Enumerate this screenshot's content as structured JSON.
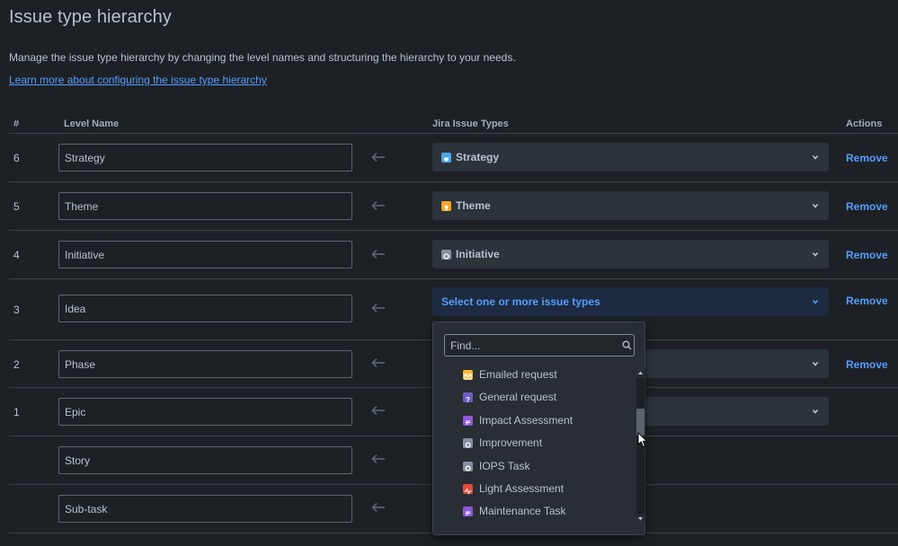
{
  "page": {
    "title": "Issue type hierarchy",
    "description": "Manage the issue type hierarchy by changing the level names and structuring the hierarchy to your needs.",
    "learn_link": "Learn more about configuring the issue type hierarchy"
  },
  "table": {
    "headers": {
      "number": "#",
      "level_name": "Level Name",
      "issue_types": "Jira Issue Types",
      "actions": "Actions"
    },
    "rows": [
      {
        "number": "6",
        "level_name": "Strategy",
        "issue_type": "Strategy",
        "icon": "strategy-icon",
        "icon_color": "#4aa7e8",
        "remove": "Remove"
      },
      {
        "number": "5",
        "level_name": "Theme",
        "issue_type": "Theme",
        "icon": "theme-icon",
        "icon_color": "#f5a623",
        "remove": "Remove"
      },
      {
        "number": "4",
        "level_name": "Initiative",
        "issue_type": "Initiative",
        "icon": "initiative-icon",
        "icon_color": "#8590a2",
        "remove": "Remove"
      },
      {
        "number": "3",
        "level_name": "Idea",
        "issue_type": "Select one or more issue types",
        "remove": "Remove"
      },
      {
        "number": "2",
        "level_name": "Phase",
        "remove": "Remove"
      },
      {
        "number": "1",
        "level_name": "Epic"
      },
      {
        "number": "",
        "level_name": "Story"
      },
      {
        "number": "",
        "level_name": "Sub-task"
      }
    ]
  },
  "dropdown": {
    "search_placeholder": "Find...",
    "options": [
      {
        "label": "Emailed request",
        "icon": "emailed-request-icon",
        "color": "#f5b73b"
      },
      {
        "label": "General request",
        "icon": "general-request-icon",
        "color": "#6e5dc6"
      },
      {
        "label": "Impact Assessment",
        "icon": "impact-assessment-icon",
        "color": "#8f59d8"
      },
      {
        "label": "Improvement",
        "icon": "improvement-icon",
        "color": "#8590a2"
      },
      {
        "label": "IOPS Task",
        "icon": "iops-task-icon",
        "color": "#8590a2"
      },
      {
        "label": "Light Assessment",
        "icon": "light-assessment-icon",
        "color": "#e5493a"
      },
      {
        "label": "Maintenance Task",
        "icon": "maintenance-task-icon",
        "color": "#8f59d8"
      }
    ]
  },
  "colors": {
    "background": "#1d2125",
    "link": "#579dff",
    "text": "#b6c2cf"
  }
}
